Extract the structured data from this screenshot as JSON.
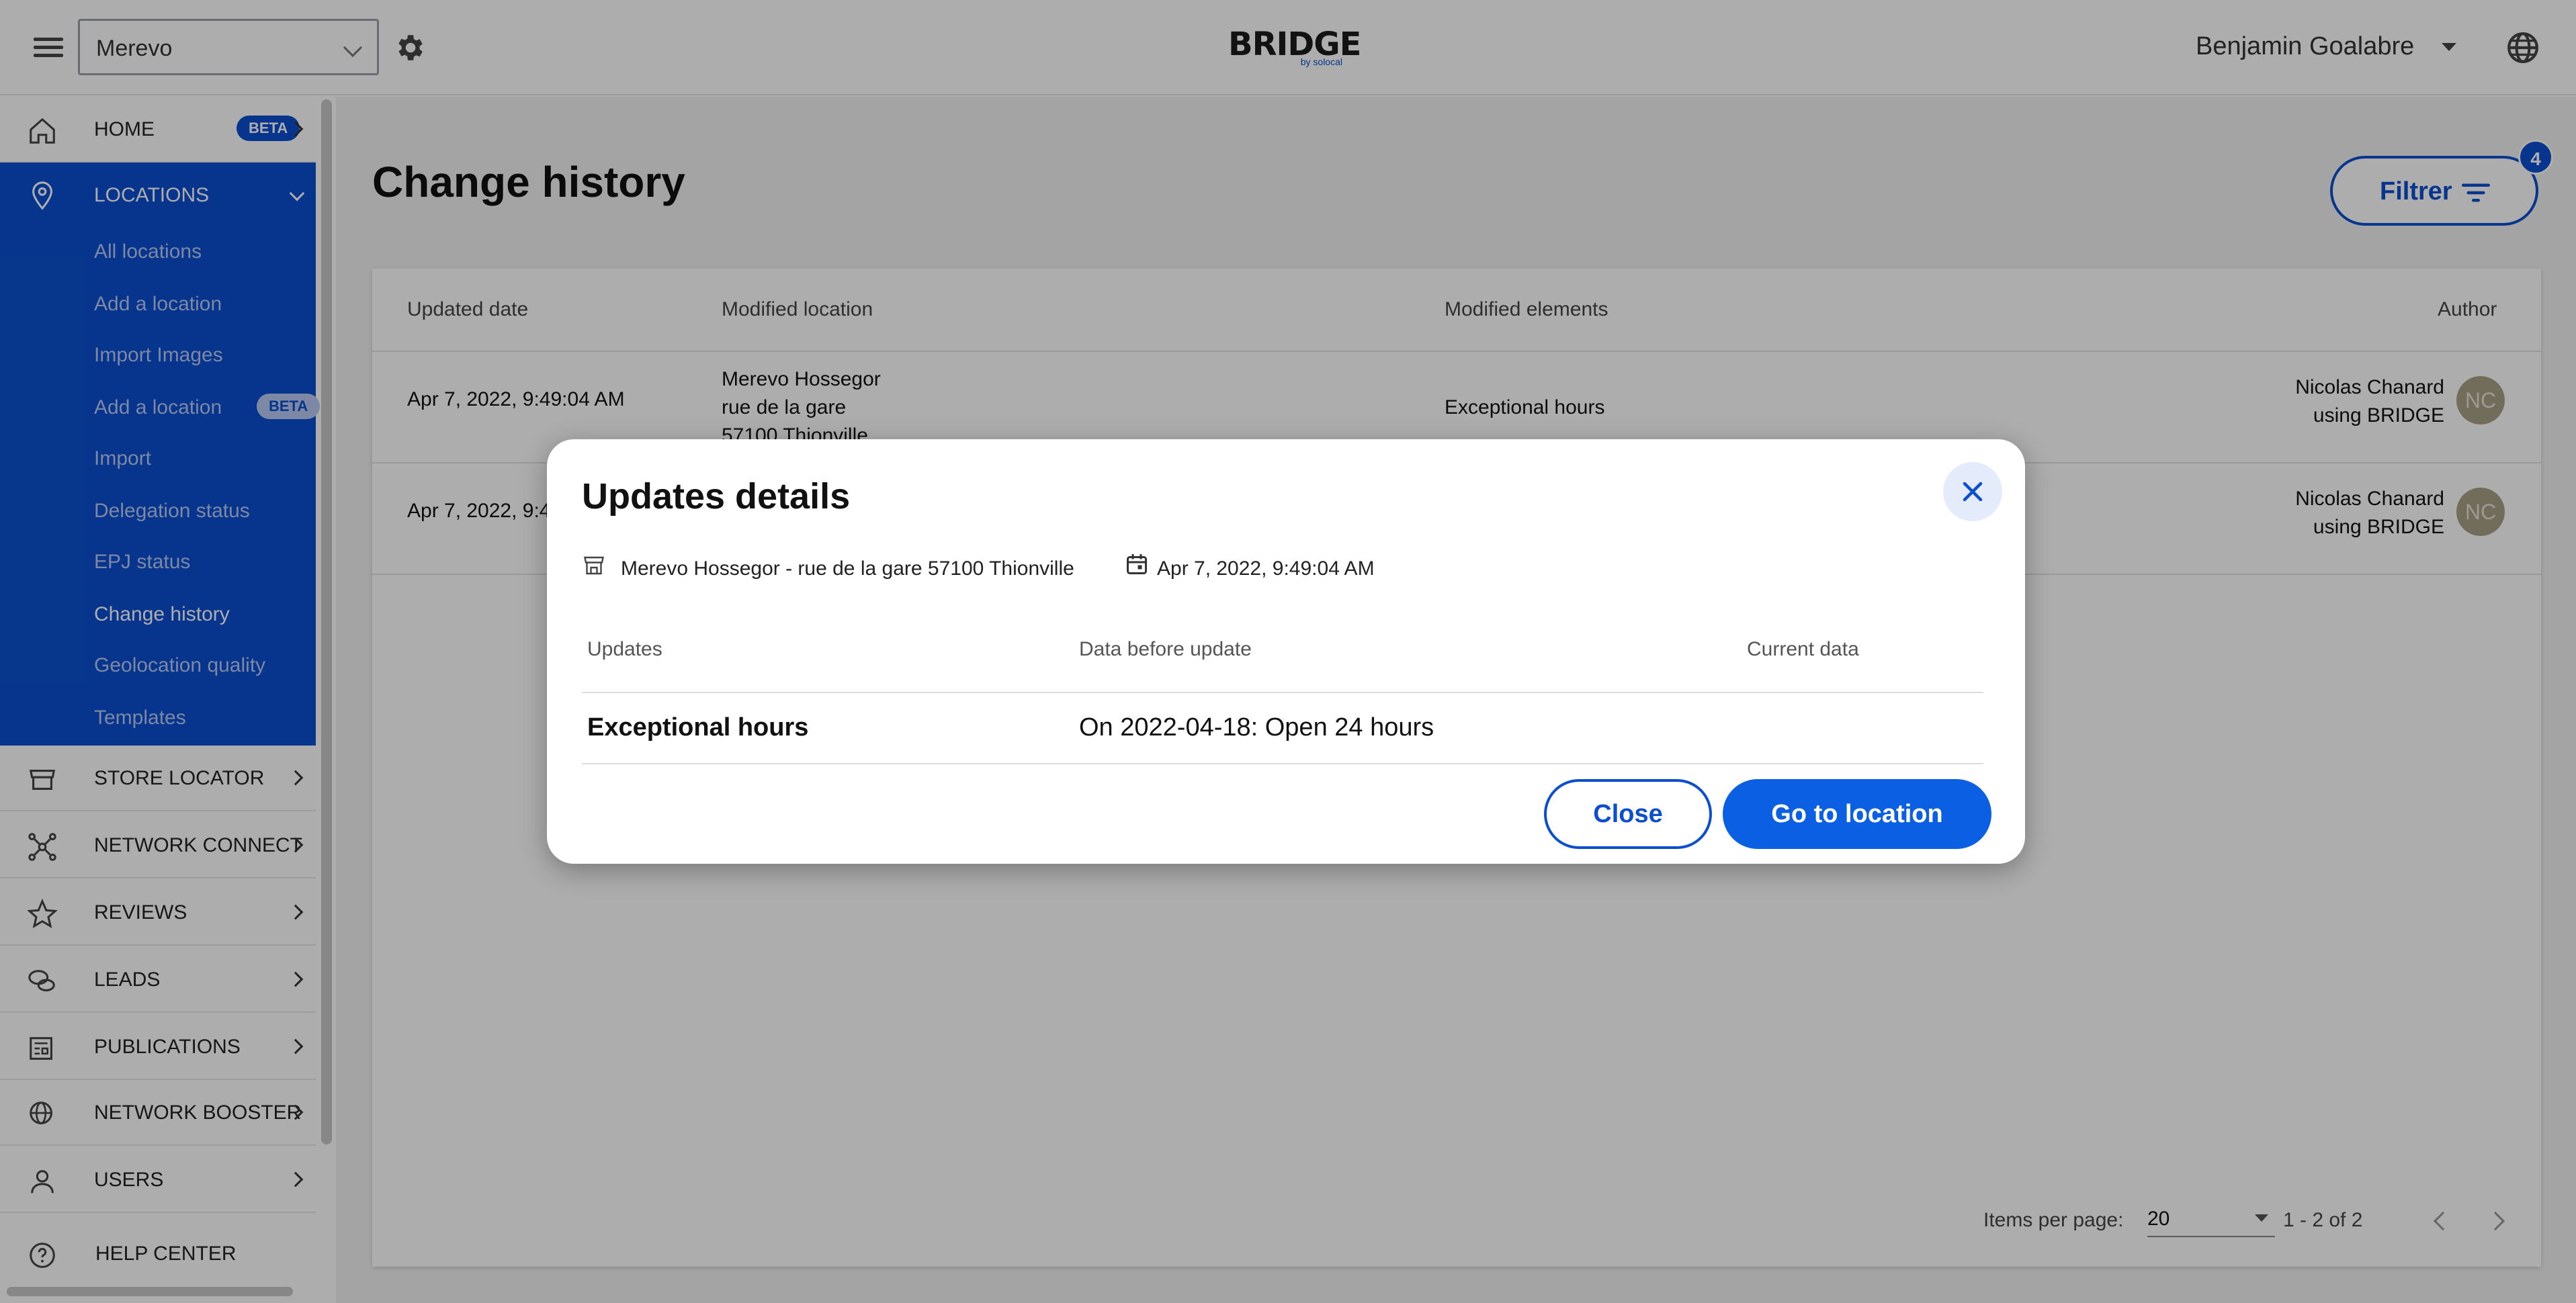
{
  "topbar": {
    "account": "Merevo",
    "logo_text": "BRIDGE",
    "logo_sub": "by solocal",
    "user_name": "Benjamin Goalabre"
  },
  "sidebar": {
    "home": "HOME",
    "beta": "BETA",
    "locations": "LOCATIONS",
    "location_items": [
      "All locations",
      "Add a location",
      "Import Images",
      "Add a location",
      "Import",
      "Delegation status",
      "EPJ status",
      "Change history",
      "Geolocation quality",
      "Templates"
    ],
    "store_locator": "STORE LOCATOR",
    "network_connect": "NETWORK CONNECT",
    "reviews": "REVIEWS",
    "leads": "LEADS",
    "publications": "PUBLICATIONS",
    "network_booster": "NETWORK BOOSTER",
    "users": "USERS",
    "help_center": "HELP CENTER"
  },
  "page": {
    "title": "Change history",
    "filter_label": "Filtrer",
    "filter_count": "4"
  },
  "table": {
    "headers": [
      "Updated date",
      "Modified location",
      "Modified elements",
      "Author"
    ],
    "rows": [
      {
        "date": "Apr 7, 2022, 9:49:04 AM",
        "location_lines": [
          "Merevo Hossegor",
          "rue de la gare",
          "57100 Thionville"
        ],
        "elements": "Exceptional hours",
        "author_lines": [
          "Nicolas Chanard",
          "using BRIDGE"
        ],
        "initials": "NC"
      },
      {
        "date": "Apr 7, 2022, 9:4",
        "location_lines": [],
        "elements": "",
        "author_lines": [
          "Nicolas Chanard",
          "using BRIDGE"
        ],
        "initials": "NC"
      }
    ]
  },
  "paginator": {
    "items_label": "Items per page:",
    "page_size": "20",
    "range": "1 - 2 of 2"
  },
  "dialog": {
    "title": "Updates details",
    "location": "Merevo Hossegor - rue de la gare 57100 Thionville",
    "date": "Apr 7, 2022, 9:49:04 AM",
    "headers": [
      "Updates",
      "Data before update",
      "Current data"
    ],
    "row": {
      "update": "Exceptional hours",
      "before": "On 2022-04-18: Open 24 hours",
      "current": ""
    },
    "close_label": "Close",
    "go_label": "Go to location"
  },
  "colors": {
    "brand_blue": "#0b4fd0",
    "primary_button": "#0b5fe3"
  }
}
